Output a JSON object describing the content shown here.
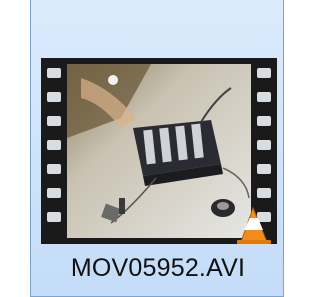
{
  "file": {
    "name": "MOV05952.AVI",
    "icon": "film-strip-video-thumbnail",
    "overlay_icon": "vlc-cone-icon",
    "selected": true
  },
  "colors": {
    "selection_bg": "#cfe3fb",
    "selection_border": "#7da2ce",
    "film_strip": "#1a1a1a",
    "vlc_orange": "#f28c1a"
  }
}
